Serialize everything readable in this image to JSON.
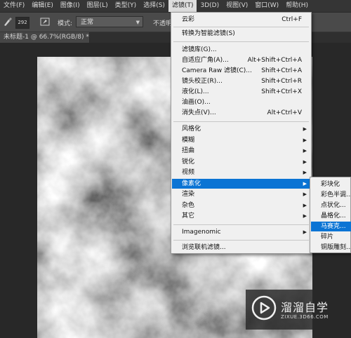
{
  "menubar": {
    "items": [
      {
        "label": "文件(F)"
      },
      {
        "label": "编辑(E)"
      },
      {
        "label": "图像(I)"
      },
      {
        "label": "图层(L)"
      },
      {
        "label": "类型(Y)"
      },
      {
        "label": "选择(S)"
      },
      {
        "label": "滤镜(T)"
      },
      {
        "label": "3D(D)"
      },
      {
        "label": "视图(V)"
      },
      {
        "label": "窗口(W)"
      },
      {
        "label": "帮助(H)"
      }
    ]
  },
  "options": {
    "brush_size": "292",
    "mode_label": "模式:",
    "mode_value": "正常",
    "opacity_label": "不透明"
  },
  "document": {
    "tab_title": "未标题-1 @ 66.7%(RGB/8) *",
    "close_glyph": "×"
  },
  "filter_menu": {
    "items": [
      {
        "label": "云彩",
        "shortcut": "Ctrl+F"
      },
      {
        "label": "转换为智能滤镜(S)",
        "shortcut": ""
      },
      {
        "label": "滤镜库(G)...",
        "shortcut": ""
      },
      {
        "label": "自适应广角(A)...",
        "shortcut": "Alt+Shift+Ctrl+A"
      },
      {
        "label": "Camera Raw 滤镜(C)...",
        "shortcut": "Shift+Ctrl+A"
      },
      {
        "label": "镜头校正(R)...",
        "shortcut": "Shift+Ctrl+R"
      },
      {
        "label": "液化(L)...",
        "shortcut": "Shift+Ctrl+X"
      },
      {
        "label": "油画(O)...",
        "shortcut": ""
      },
      {
        "label": "消失点(V)...",
        "shortcut": "Alt+Ctrl+V"
      },
      {
        "label": "风格化",
        "shortcut": ""
      },
      {
        "label": "模糊",
        "shortcut": ""
      },
      {
        "label": "扭曲",
        "shortcut": ""
      },
      {
        "label": "锐化",
        "shortcut": ""
      },
      {
        "label": "视频",
        "shortcut": ""
      },
      {
        "label": "像素化",
        "shortcut": ""
      },
      {
        "label": "渲染",
        "shortcut": ""
      },
      {
        "label": "杂色",
        "shortcut": ""
      },
      {
        "label": "其它",
        "shortcut": ""
      },
      {
        "label": "Imagenomic",
        "shortcut": ""
      },
      {
        "label": "浏览联机滤镜...",
        "shortcut": ""
      }
    ]
  },
  "pixelate_submenu": {
    "items": [
      {
        "label": "彩块化"
      },
      {
        "label": "彩色半调..."
      },
      {
        "label": "点状化..."
      },
      {
        "label": "晶格化..."
      },
      {
        "label": "马赛克..."
      },
      {
        "label": "碎片"
      },
      {
        "label": "铜版雕刻..."
      }
    ]
  },
  "watermark": {
    "title": "溜溜自学",
    "subtitle": "ZIXUE.3D66.COM"
  },
  "colors": {
    "accent": "#0b74d4",
    "menu_bg": "#f0f0f0",
    "app_bg": "#353535"
  }
}
